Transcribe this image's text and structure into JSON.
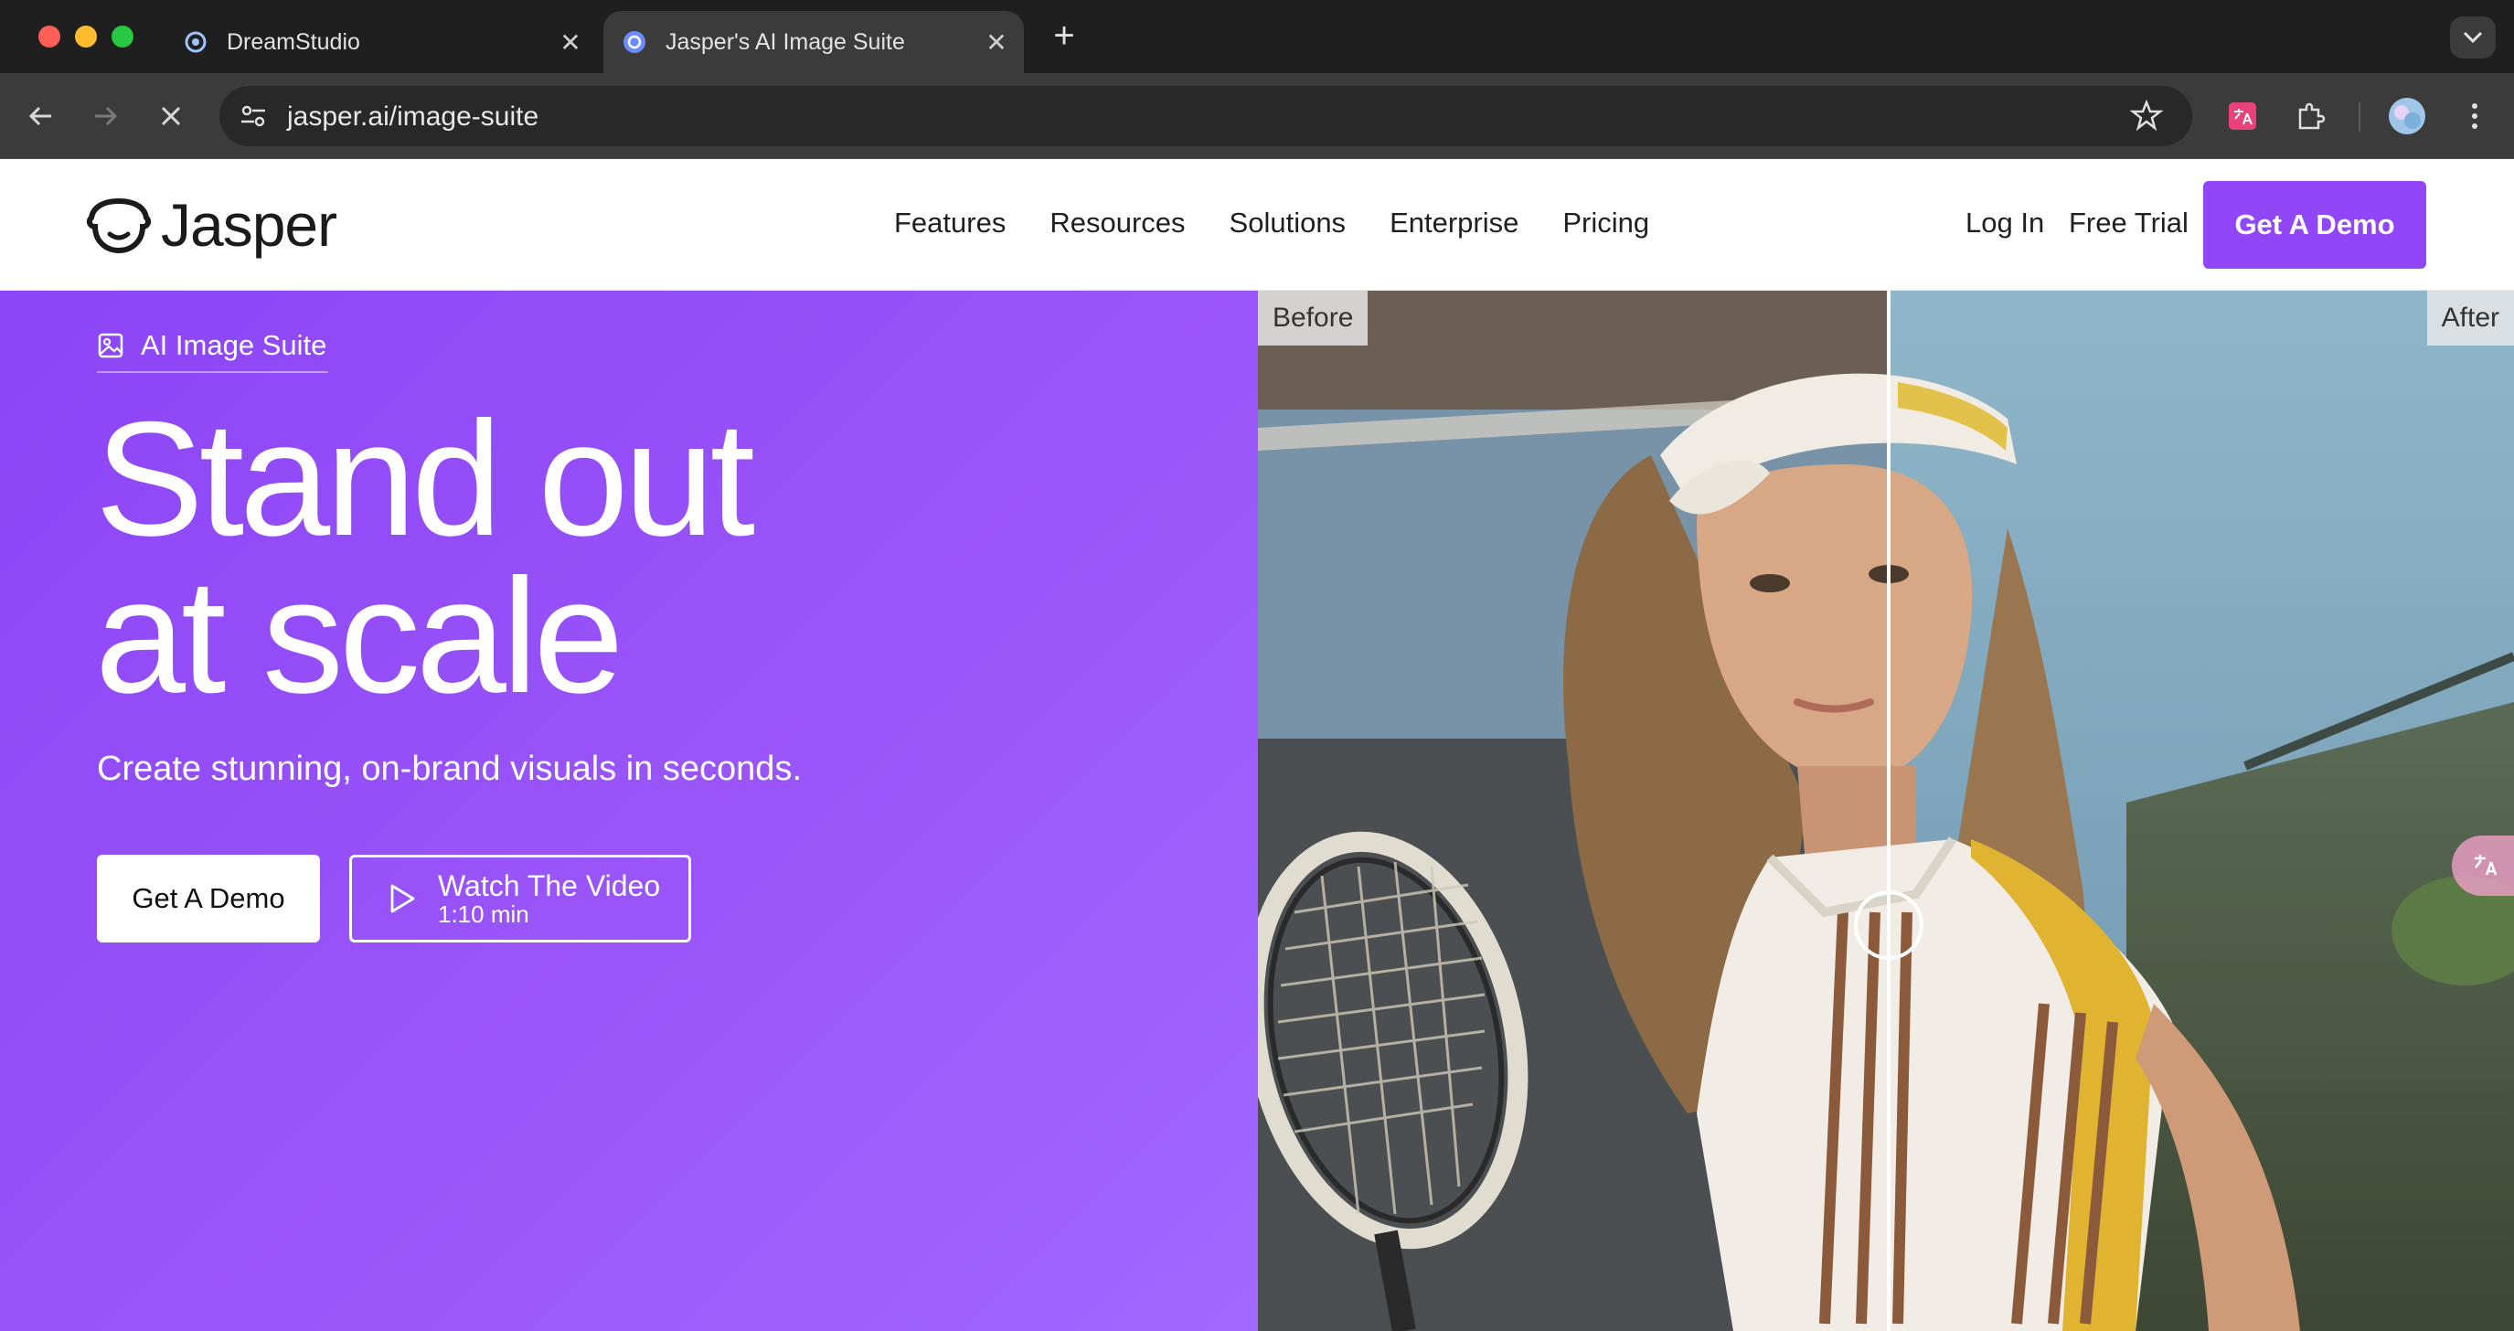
{
  "browser": {
    "tabs": [
      {
        "title": "DreamStudio",
        "active": false
      },
      {
        "title": "Jasper's AI Image Suite",
        "active": true
      }
    ],
    "new_tab_symbol": "+",
    "close_symbol": "✕",
    "url": "jasper.ai/image-suite",
    "colors": {
      "chrome_dark": "#1f1f1f",
      "chrome_toolbar": "#3b3b3b"
    }
  },
  "site": {
    "logo_text": "Jasper",
    "nav": [
      "Features",
      "Resources",
      "Solutions",
      "Enterprise",
      "Pricing"
    ],
    "login": "Log In",
    "free_trial": "Free Trial",
    "get_demo": "Get A Demo",
    "accent": "#9147f7"
  },
  "hero": {
    "eyebrow": "AI Image Suite",
    "headline_line1": "Stand out",
    "headline_line2": "at scale",
    "subheadline": "Create stunning, on-brand visuals in seconds.",
    "primary_button": "Get A Demo",
    "video_button_title": "Watch The Video",
    "video_button_duration": "1:10 min"
  },
  "comparison": {
    "before_label": "Before",
    "after_label": "After",
    "slider_position": 0.5
  }
}
